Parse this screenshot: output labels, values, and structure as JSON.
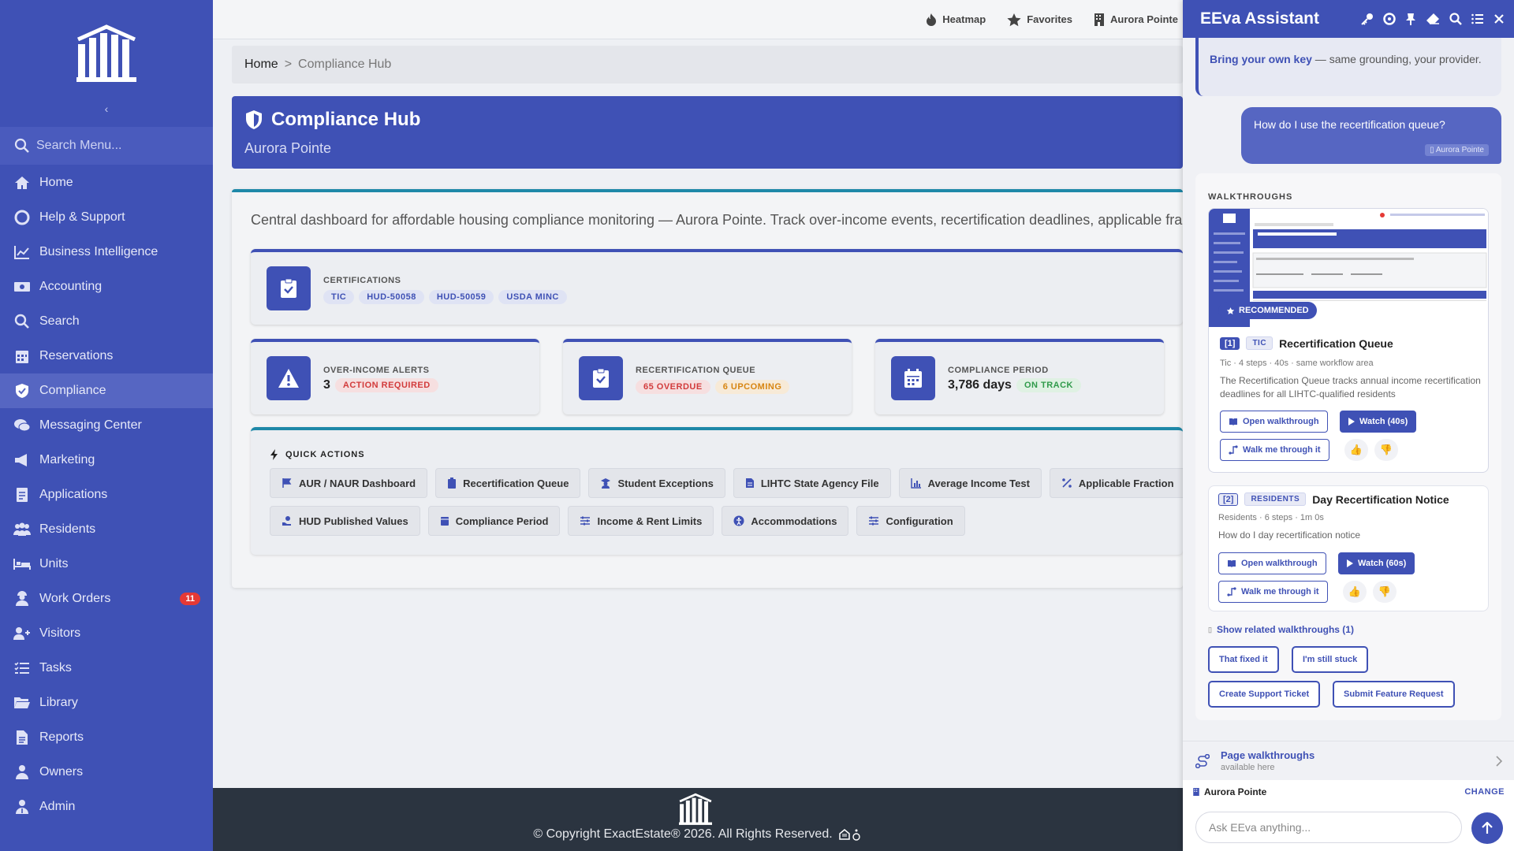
{
  "sidebar": {
    "collapse_glyph": "‹",
    "search_placeholder": "Search Menu...",
    "items": [
      {
        "label": "Home",
        "icon": "home-icon"
      },
      {
        "label": "Help & Support",
        "icon": "lifebuoy-icon"
      },
      {
        "label": "Business Intelligence",
        "icon": "chart-line-icon"
      },
      {
        "label": "Accounting",
        "icon": "money-icon"
      },
      {
        "label": "Search",
        "icon": "search-icon"
      },
      {
        "label": "Reservations",
        "icon": "calendar-icon"
      },
      {
        "label": "Compliance",
        "icon": "shield-check-icon",
        "active": true
      },
      {
        "label": "Messaging Center",
        "icon": "comments-icon"
      },
      {
        "label": "Marketing",
        "icon": "megaphone-icon"
      },
      {
        "label": "Applications",
        "icon": "document-icon"
      },
      {
        "label": "Residents",
        "icon": "users-icon"
      },
      {
        "label": "Units",
        "icon": "bed-icon"
      },
      {
        "label": "Work Orders",
        "icon": "worker-icon",
        "badge": "11"
      },
      {
        "label": "Visitors",
        "icon": "user-plus-icon"
      },
      {
        "label": "Tasks",
        "icon": "list-icon"
      },
      {
        "label": "Library",
        "icon": "folder-icon"
      },
      {
        "label": "Reports",
        "icon": "report-icon"
      },
      {
        "label": "Owners",
        "icon": "owner-icon"
      },
      {
        "label": "Admin",
        "icon": "admin-icon"
      }
    ]
  },
  "topbar": {
    "heatmap": "Heatmap",
    "favorites": "Favorites",
    "property": "Aurora Pointe"
  },
  "breadcrumb": {
    "home": "Home",
    "sep": ">",
    "current": "Compliance Hub"
  },
  "hero": {
    "title": "Compliance Hub",
    "subtitle": "Aurora Pointe"
  },
  "main": {
    "description": "Central dashboard for affordable housing compliance monitoring — Aurora Pointe. Track over-income events, recertification deadlines, applicable fraction",
    "certifications": {
      "label": "CERTIFICATIONS",
      "tags": [
        "TIC",
        "HUD-50058",
        "HUD-50059",
        "USDA MINC"
      ]
    },
    "over_income": {
      "label": "OVER-INCOME ALERTS",
      "value": "3",
      "tag": "ACTION REQUIRED"
    },
    "recert_queue": {
      "label": "RECERTIFICATION QUEUE",
      "overdue": "65 OVERDUE",
      "upcoming": "6 UPCOMING"
    },
    "compliance_period": {
      "label": "COMPLIANCE PERIOD",
      "value": "3,786 days",
      "tag": "ON TRACK"
    },
    "quick_actions": {
      "title": "QUICK ACTIONS",
      "row1": [
        {
          "label": "AUR / NAUR Dashboard",
          "icon": "flag-icon"
        },
        {
          "label": "Recertification Queue",
          "icon": "clipboard-icon"
        },
        {
          "label": "Student Exceptions",
          "icon": "graduate-icon"
        },
        {
          "label": "LIHTC State Agency File",
          "icon": "file-icon"
        },
        {
          "label": "Average Income Test",
          "icon": "bar-chart-icon"
        },
        {
          "label": "Applicable Fraction",
          "icon": "percent-icon"
        }
      ],
      "row2": [
        {
          "label": "HUD Published Values",
          "icon": "hand-dollar-icon"
        },
        {
          "label": "Compliance Period",
          "icon": "calendar-icon"
        },
        {
          "label": "Income & Rent Limits",
          "icon": "sliders-icon"
        },
        {
          "label": "Accommodations",
          "icon": "accessibility-icon"
        },
        {
          "label": "Configuration",
          "icon": "sliders-icon"
        }
      ]
    }
  },
  "footer": {
    "copyright": "© Copyright ExactEstate® 2026. All Rights Reserved."
  },
  "assistant": {
    "title": "EEva Assistant",
    "ai_msg_link": "Bring your own key",
    "ai_msg_rest": " — same grounding, your provider.",
    "user_msg": "How do I use the recertification queue?",
    "user_ctx": "Aurora Pointe",
    "walkthroughs_header": "WALKTHROUGHS",
    "recommended": "RECOMMENDED",
    "w1": {
      "num": "[1]",
      "cat": "TIC",
      "title": "Recertification Queue",
      "meta": "Tic · 4 steps · 40s · same workflow area",
      "desc": "The Recertification Queue tracks annual income recertification deadlines for all LIHTC-qualified residents",
      "open": "Open walkthrough",
      "watch": "Watch  (40s)",
      "walk": "Walk me through it"
    },
    "w2": {
      "num": "[2]",
      "cat": "RESIDENTS",
      "title": "Day Recertification Notice",
      "meta": "Residents · 6 steps · 1m 0s",
      "desc": "How do I day recertification notice",
      "open": "Open walkthrough",
      "watch": "Watch  (60s)",
      "walk": "Walk me through it"
    },
    "related": "Show related walkthroughs (1)",
    "fixed": "That fixed it",
    "stuck": "I'm still stuck",
    "ticket": "Create Support Ticket",
    "feature": "Submit Feature Request",
    "page_walk_title": "Page walkthroughs",
    "page_walk_sub": "available here",
    "property": "Aurora Pointe",
    "change": "CHANGE",
    "ask_placeholder": "Ask EEva anything..."
  },
  "colors": {
    "primary": "#3f51b5",
    "teal": "#1e88a8",
    "danger": "#e53935",
    "footer": "#2b3440"
  }
}
